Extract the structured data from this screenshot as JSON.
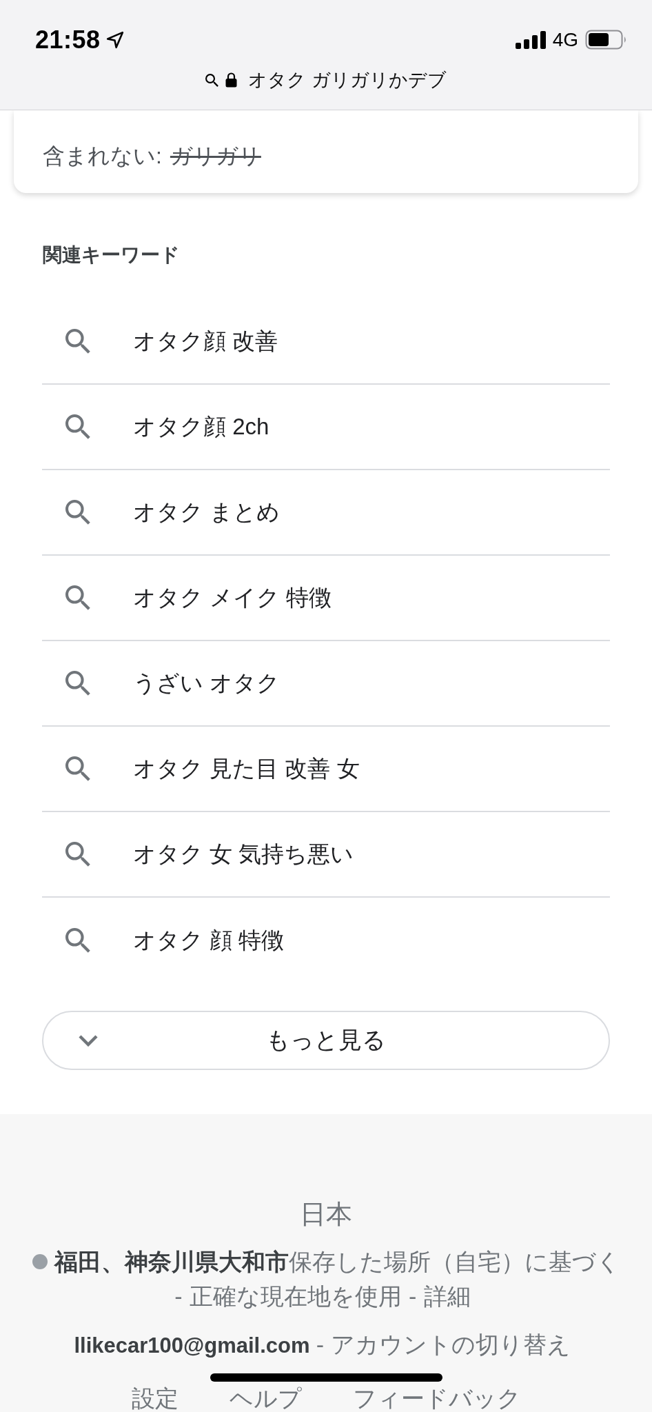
{
  "status_bar": {
    "time": "21:58",
    "network": "4G"
  },
  "address_bar": {
    "query": "オタク ガリガリかデブ"
  },
  "result_card": {
    "missing_label": "含まれない:",
    "missing_terms": [
      "ガリガリ"
    ]
  },
  "related_searches": {
    "title": "関連キーワード",
    "items": [
      "オタク顔 改善",
      "オタク顔 2ch",
      "オタク まとめ",
      "オタク メイク 特徴",
      "うざい オタク",
      "オタク 見た目 改善 女",
      "オタク 女 気持ち悪い",
      "オタク 顔 特徴"
    ]
  },
  "more_button": {
    "label": "もっと見る"
  },
  "footer": {
    "country": "日本",
    "location": {
      "summary": "**福田、神奈川県大和市**保存した場所（自宅）に基づく",
      "actions": [
        {
          "kind": "separator",
          "text": "-"
        },
        {
          "kind": "link",
          "text": "正確な現在地を使用"
        },
        {
          "kind": "separator",
          "text": "-"
        },
        {
          "kind": "link",
          "text": "詳細"
        }
      ]
    },
    "account": {
      "email": "llikecar100@gmail.com",
      "separator": "-",
      "switch_link": "アカウントの切り替え"
    },
    "links": [
      "設定",
      "ヘルプ",
      "フィードバック"
    ]
  }
}
